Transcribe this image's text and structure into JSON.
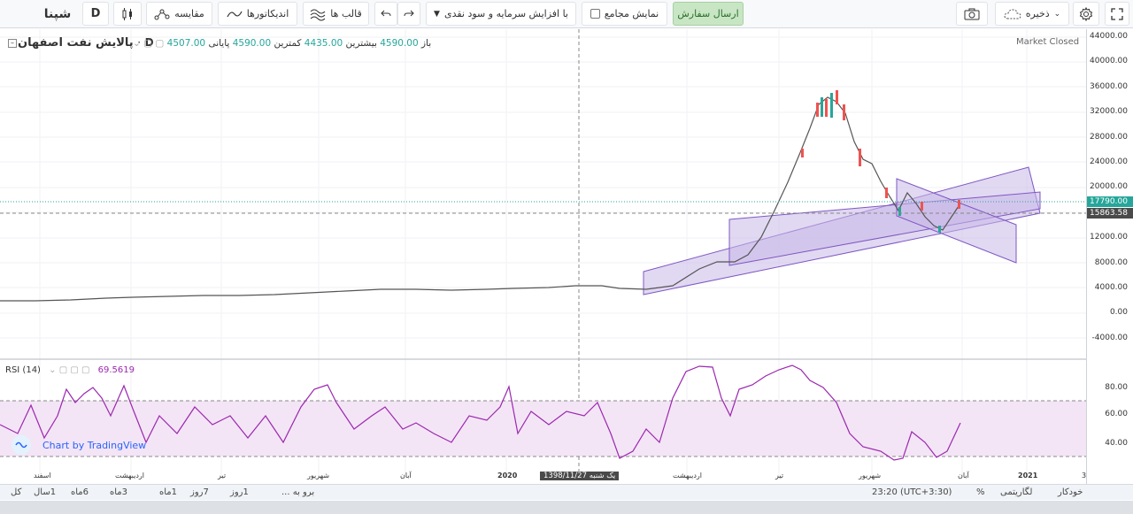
{
  "toolbar": {
    "symbol_code": "شپنا",
    "interval": "D",
    "compare_label": "مقایسه",
    "indicators_label": "اندیکاتورها",
    "templates_label": "قالب ها",
    "adjustment_select": "با افزایش سرمایه و سود نقدی",
    "show_meetings_label": "نمایش مجامع",
    "send_order_label": "ارسال سفارش",
    "save_label": "ذخیره"
  },
  "legend": {
    "title": "پالایش نفت اصفهان",
    "interval": "D",
    "open_label": "باز",
    "open_value": "4507.00",
    "high_label": "بیشترین",
    "high_value": "4590.00",
    "low_label": "کمترین",
    "low_value": "4435.00",
    "close_label": "پایانی",
    "close_value": "4590.00",
    "market_status": "Market Closed"
  },
  "price_axis": [
    "44000.00",
    "40000.00",
    "36000.00",
    "32000.00",
    "28000.00",
    "24000.00",
    "20000.00",
    "16000.00",
    "12000.00",
    "8000.00",
    "4000.00",
    "0.00",
    "-4000.00"
  ],
  "price_tags": {
    "last_price": "17790.00",
    "crosshair_price": "15863.58",
    "last_color": "#26a69a",
    "crosshair_color": "#4a4a4a"
  },
  "rsi": {
    "label": "RSI (14)",
    "value": "69.5619",
    "axis": [
      "80.00",
      "60.00",
      "40.00"
    ],
    "color": "#9c27b0",
    "band_color": "#f3e5f5"
  },
  "time_axis": {
    "labels": [
      "اسفند",
      "اردیبهشت",
      "تیر",
      "شهریور",
      "آبان",
      "2020",
      "اردیبهشت",
      "تیر",
      "شهریور",
      "آبان",
      "2021",
      "3"
    ],
    "crosshair_date": "1398/11/27",
    "crosshair_day": "یک شنبه"
  },
  "watermark": "Chart by TradingView",
  "bottom_bar": {
    "ranges": [
      "کل",
      "1سال",
      "6ماه",
      "3ماه",
      "1ماه",
      "7روز",
      "1روز"
    ],
    "goto_label": "برو به ...",
    "time_label": "23:20 (UTC+3:30)",
    "percent_label": "%",
    "log_label": "لگاریتمی",
    "auto_label": "خودکار"
  }
}
